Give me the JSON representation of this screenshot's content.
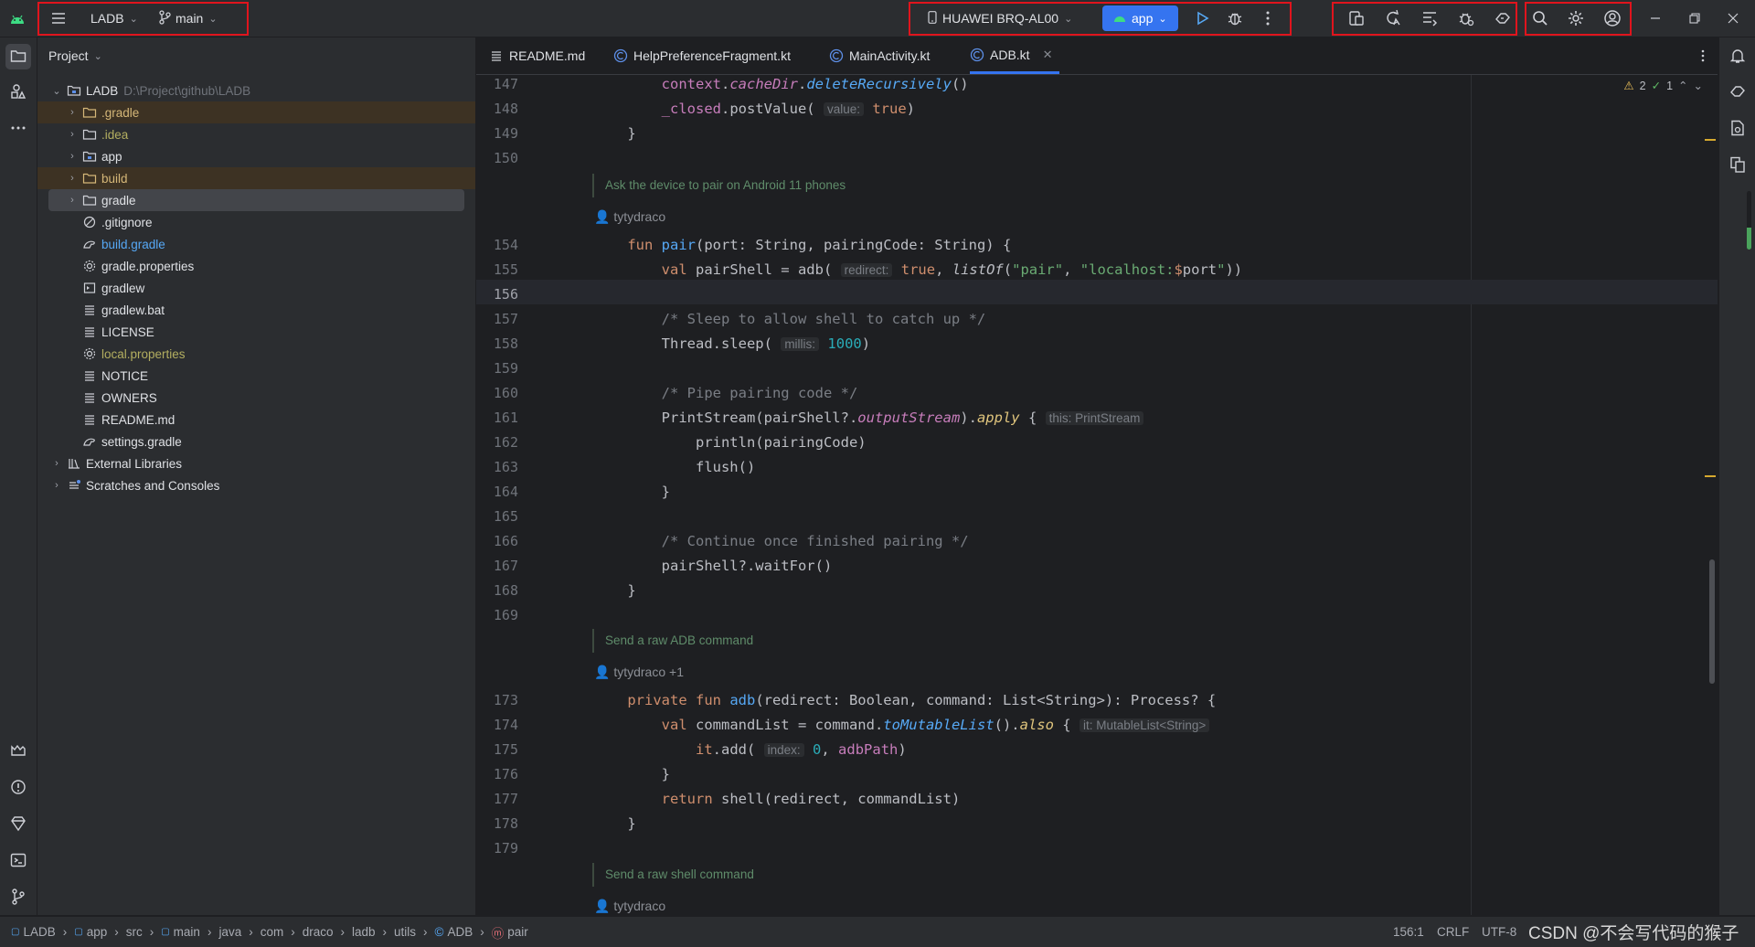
{
  "toolbar": {
    "project_name": "LADB",
    "branch": "main",
    "device": "HUAWEI BRQ-AL00",
    "run_config": "app"
  },
  "project_panel": {
    "title": "Project",
    "root_name": "LADB",
    "root_path": "D:\\Project\\github\\LADB",
    "items": [
      {
        "label": ".gradle"
      },
      {
        "label": ".idea"
      },
      {
        "label": "app"
      },
      {
        "label": "build"
      },
      {
        "label": "gradle"
      },
      {
        "label": ".gitignore"
      },
      {
        "label": "build.gradle"
      },
      {
        "label": "gradle.properties"
      },
      {
        "label": "gradlew"
      },
      {
        "label": "gradlew.bat"
      },
      {
        "label": "LICENSE"
      },
      {
        "label": "local.properties"
      },
      {
        "label": "NOTICE"
      },
      {
        "label": "OWNERS"
      },
      {
        "label": "README.md"
      },
      {
        "label": "settings.gradle"
      },
      {
        "label": "External Libraries"
      },
      {
        "label": "Scratches and Consoles"
      }
    ]
  },
  "tabs": [
    {
      "label": "README.md"
    },
    {
      "label": "HelpPreferenceFragment.kt"
    },
    {
      "label": "MainActivity.kt"
    },
    {
      "label": "ADB.kt",
      "active": true
    }
  ],
  "inspections": {
    "warnings": "2",
    "ok": "1"
  },
  "editor": {
    "line_numbers": [
      "147",
      "148",
      "149",
      "150",
      "154",
      "155",
      "156",
      "157",
      "158",
      "159",
      "160",
      "161",
      "162",
      "163",
      "164",
      "165",
      "166",
      "167",
      "168",
      "169",
      "173",
      "174",
      "175",
      "176",
      "177",
      "178",
      "179"
    ],
    "docs": [
      "Ask the device to pair on Android 11 phones",
      "Send a raw ADB command",
      "Send a raw shell command"
    ],
    "authors": [
      "tytydraco",
      "tytydraco +1",
      "tytydraco"
    ],
    "hints": {
      "value": "value:",
      "redirect": "redirect:",
      "millis": "millis:",
      "this_printstream": "this: PrintStream",
      "it_mutablelist": "it: MutableList<String>",
      "index": "index:"
    }
  },
  "breadcrumbs": [
    "LADB",
    "app",
    "src",
    "main",
    "java",
    "com",
    "draco",
    "ladb",
    "utils",
    "ADB",
    "pair"
  ],
  "status": {
    "position": "156:1",
    "line_sep": "CRLF",
    "encoding": "UTF-8",
    "watermark": "CSDN @不会写代码的猴子"
  },
  "colors": {
    "accent": "#3574f0",
    "highlight_box": "#e0141d"
  }
}
